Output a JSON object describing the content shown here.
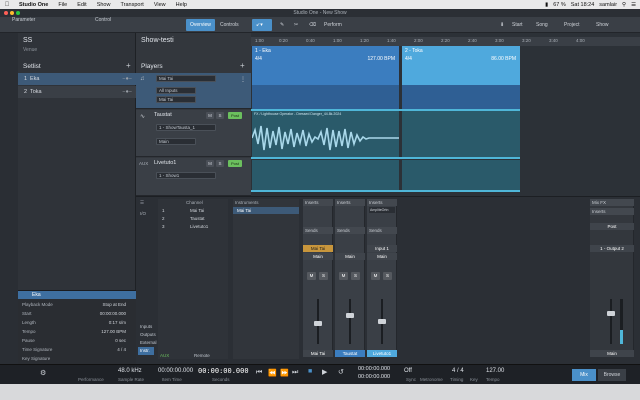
{
  "menubar": {
    "app": "Studio One",
    "items": [
      "File",
      "Edit",
      "Show",
      "Transport",
      "View",
      "Help"
    ],
    "right": {
      "battery": "67 %",
      "clock": "Sat 18:24",
      "user": "samlair"
    }
  },
  "window": {
    "title": "Studio One - New Show"
  },
  "toolbar": {
    "parameter": "Parameter",
    "control": "Control",
    "overview": "Overview",
    "controls": "Controls",
    "perform": "Perform",
    "start": "Start",
    "song": "Song",
    "project": "Project",
    "show": "Show"
  },
  "setlist": {
    "show_name": "SS",
    "venue": "Venue",
    "heading": "Setlist",
    "items": [
      {
        "num": "1",
        "label": "Eka"
      },
      {
        "num": "2",
        "label": "Toka"
      }
    ]
  },
  "inspector": {
    "selected": "Eka",
    "rows": [
      {
        "label": "Playback Mode",
        "value": "Stop at End"
      },
      {
        "label": "Start",
        "value": "00:00:00.000"
      },
      {
        "label": "Length",
        "value": "0:17 s/m"
      },
      {
        "label": "Tempo",
        "value": "127.00 BPM"
      },
      {
        "label": "Pause",
        "value": "0 sec"
      },
      {
        "label": "Time Signature",
        "value": "4 / 4"
      },
      {
        "label": "Key Signature",
        "value": ""
      }
    ]
  },
  "players": {
    "show_title": "Show-testi",
    "heading": "Players",
    "tracks": [
      {
        "name": "Mai Tai",
        "input": "All Inputs",
        "output": "Mai Tai"
      },
      {
        "name": "Taustat",
        "region": "1 - ShowTausta_1",
        "send": "Main",
        "post": "Post"
      },
      {
        "name": "Livetuto1",
        "type": "AUX",
        "region": "1 - Show1",
        "post": "Post"
      }
    ],
    "m": "M",
    "s": "S"
  },
  "arrange": {
    "ruler": [
      "1:00",
      "0:20",
      "0:40",
      "1:00",
      "1:20",
      "1:40",
      "2:00",
      "2:20",
      "2:40",
      "3:00",
      "3:20",
      "3:40",
      "4:00"
    ],
    "sections": [
      {
        "title": "1 - Eka",
        "sig": "4/4",
        "bpm": "127.00 BPM"
      },
      {
        "title": "2 - Toka",
        "sig": "4/4",
        "bpm": "86.00 BPM"
      }
    ],
    "wave_label": "FX / Lighthouse Operator - Dressed Danger_44.8k.2024"
  },
  "console": {
    "left_buttons": [
      "Inputs",
      "Outputs",
      "External",
      "Instr."
    ],
    "io": "I/O",
    "channel_header": "Channel",
    "channels": [
      {
        "num": "1",
        "name": "Mai Tai"
      },
      {
        "num": "2",
        "name": "Taustat"
      },
      {
        "num": "3",
        "name": "Livetuto1"
      }
    ],
    "instruments_header": "Instruments",
    "instrument": "Mai Tai",
    "strips": [
      {
        "name": "Mai Tai",
        "out": "Main",
        "hdr": "Inserts"
      },
      {
        "name": "Taustat",
        "out": "Main",
        "hdr": "Inserts"
      },
      {
        "name": "Livetuto1",
        "out": "Input 1",
        "hdr": "Inserts",
        "insert": "AmpliteOrtn"
      }
    ],
    "sends": "Sends",
    "main": {
      "label": "Main",
      "out": "1 - Output 2",
      "mix_fx": "Mix FX",
      "post": "Post"
    },
    "aux": "AUX",
    "remote": "Remote"
  },
  "transport": {
    "sample_rate": "48.0 kHz",
    "sample_rate_label": "Sample Rate",
    "performance": "Performance",
    "item_time": "00:00:00.000",
    "item_time_label": "Item Time",
    "seconds": "00:00:00.000",
    "seconds_label": "Seconds",
    "l_time": "00:00:00.000",
    "r_time": "00:00:00.000",
    "sync": "Off",
    "sync_label": "Sync",
    "metronome": "Metronome",
    "signature": "4 / 4",
    "timing": "Timing",
    "key": "Key",
    "tempo": "127.00",
    "tempo_label": "Tempo",
    "mix": "Mix",
    "browse": "Browse"
  },
  "colors": {
    "accent": "#4a90c9",
    "arrange_blue": "#3b7dbf",
    "teal": "#2a5a6a",
    "post_green": "#6bbf5e"
  }
}
